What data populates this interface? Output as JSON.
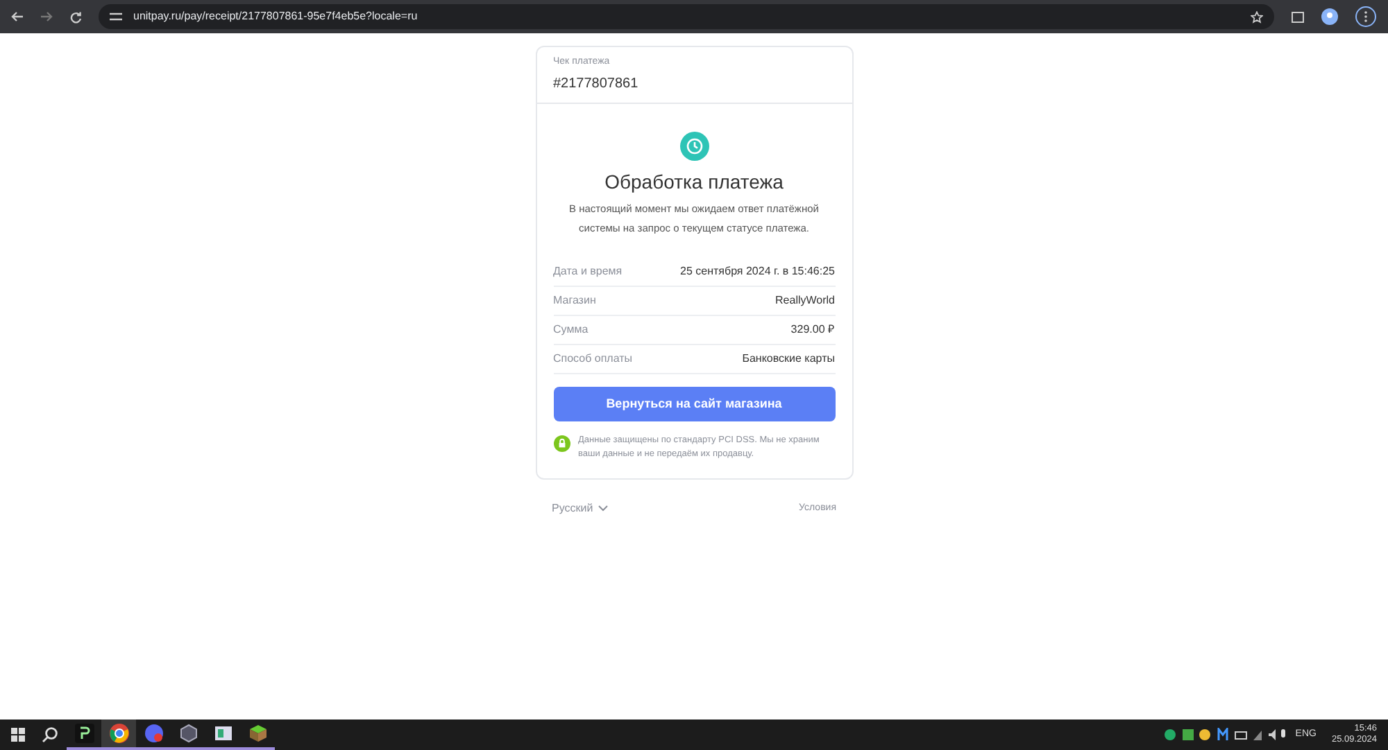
{
  "browser": {
    "url": "unitpay.ru/pay/receipt/2177807861-95e7f4eb5e?locale=ru"
  },
  "receipt": {
    "label": "Чек платежа",
    "number": "#2177807861"
  },
  "status": {
    "title": "Обработка платежа",
    "message": "В настоящий момент мы ожидаем ответ платёжной системы на запрос о текущем статусе платежа."
  },
  "details": [
    {
      "label": "Дата и время",
      "value": "25 сентября 2024 г. в 15:46:25"
    },
    {
      "label": "Магазин",
      "value": "ReallyWorld"
    },
    {
      "label": "Сумма",
      "value": "329.00 ₽"
    },
    {
      "label": "Способ оплаты",
      "value": "Банковские карты"
    }
  ],
  "return_button": "Вернуться на сайт магазина",
  "security_note": "Данные защищены по стандарту PCI DSS. Мы не храним ваши данные и не передаём их продавцу.",
  "footer": {
    "language": "Русский",
    "terms": "Условия"
  },
  "taskbar": {
    "apps": [
      {
        "kind": "terminal",
        "running": true,
        "selected": false
      },
      {
        "kind": "chrome",
        "running": true,
        "selected": true
      },
      {
        "kind": "messenger",
        "running": true,
        "selected": false
      },
      {
        "kind": "hexagon",
        "running": true,
        "selected": false
      },
      {
        "kind": "window",
        "running": true,
        "selected": false
      },
      {
        "kind": "cube",
        "running": true,
        "selected": false
      }
    ],
    "language": "ENG",
    "time": "15:46",
    "date": "25.09.2024"
  }
}
